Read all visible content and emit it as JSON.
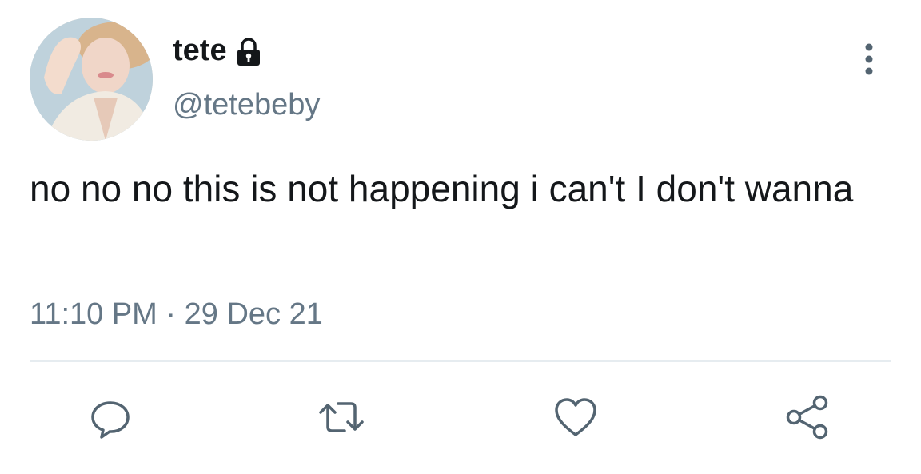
{
  "tweet": {
    "author_name": "tete",
    "author_handle": "@tetebeby",
    "text": "no no no this is not happening i can't I don't wanna",
    "time": "11:10 PM",
    "separator": "·",
    "date": "29 Dec 21"
  },
  "icons": {
    "lock": "lock-icon",
    "more": "more-vertical-icon",
    "reply": "reply-icon",
    "retweet": "retweet-icon",
    "like": "heart-icon",
    "share": "share-icon"
  },
  "colors": {
    "text": "#14171a",
    "secondary": "#657786",
    "divider": "#e6ecf0"
  }
}
